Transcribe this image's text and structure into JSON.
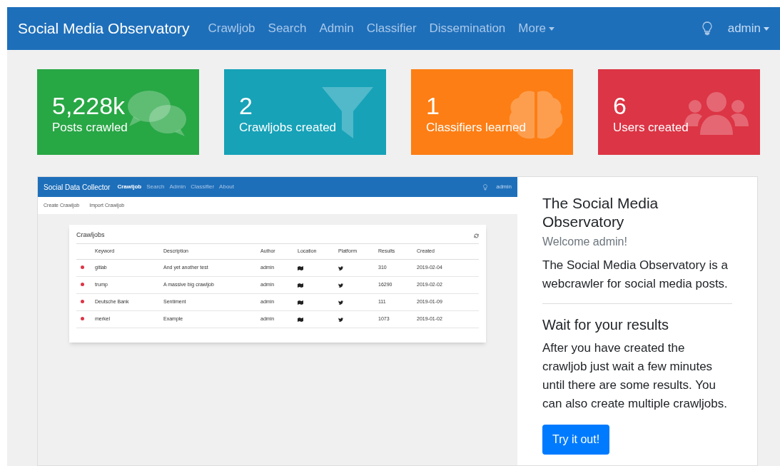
{
  "navbar": {
    "brand": "Social Media Observatory",
    "links": [
      {
        "label": "Crawljob"
      },
      {
        "label": "Search"
      },
      {
        "label": "Admin"
      },
      {
        "label": "Classifier"
      },
      {
        "label": "Dissemination"
      }
    ],
    "more": "More",
    "user": "admin"
  },
  "stats": [
    {
      "kind": "posts",
      "value": "5,228k",
      "label": "Posts crawled",
      "color": "#28a745"
    },
    {
      "kind": "crawljobs",
      "value": "2",
      "label": "Crawljobs created",
      "color": "#17a2b8"
    },
    {
      "kind": "classifiers",
      "value": "1",
      "label": "Classifiers learned",
      "color": "#fd7e14"
    },
    {
      "kind": "users",
      "value": "6",
      "label": "Users created",
      "color": "#dc3545"
    }
  ],
  "preview": {
    "brand": "Social Data Collector",
    "links": [
      {
        "label": "Crawljob",
        "selected": true
      },
      {
        "label": "Search",
        "selected": false
      },
      {
        "label": "Admin",
        "selected": false
      },
      {
        "label": "Classifier",
        "selected": false
      },
      {
        "label": "About",
        "selected": false
      }
    ],
    "user": "admin",
    "subnav": [
      "Create Crawljob",
      "Import Crawljob"
    ],
    "table_title": "Crawljobs",
    "columns": [
      "Keyword",
      "Description",
      "Author",
      "Location",
      "Platform",
      "Results",
      "Created"
    ],
    "rows": [
      {
        "color": "#dc3545",
        "keyword": "gitlab",
        "description": "And yet another test",
        "author": "admin",
        "results": "310",
        "created": "2019-02-04"
      },
      {
        "color": "#dc3545",
        "keyword": "trump",
        "description": "A massive big crawljob",
        "author": "admin",
        "results": "16290",
        "created": "2019-02-02"
      },
      {
        "color": "#dc3545",
        "keyword": "Deutsche Bank",
        "description": "Sentiment",
        "author": "admin",
        "results": "111",
        "created": "2019-01-09"
      },
      {
        "color": "#dc3545",
        "keyword": "merkel",
        "description": "Example",
        "author": "admin",
        "results": "1073",
        "created": "2019-01-02"
      }
    ]
  },
  "info": {
    "title": "The Social Media Observatory",
    "subtitle": "Welcome admin!",
    "intro": "The Social Media Observatory is a webcrawler for social media posts.",
    "heading": "Wait for your results",
    "body": "After you have created the crawljob just wait a few minutes until there are some results. You can also create multiple crawljobs.",
    "button": "Try it out!"
  }
}
